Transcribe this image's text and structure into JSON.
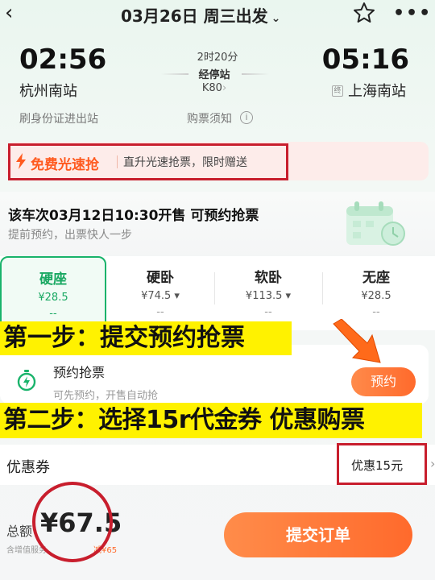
{
  "header": {
    "title": "03月26日 周三出发",
    "back_icon": "chevron-left-icon",
    "favorite_icon": "star-icon",
    "more_icon": "more-icon",
    "more_text": "•••"
  },
  "journey": {
    "depart_time": "02:56",
    "depart_station": "杭州南站",
    "arrive_time": "05:16",
    "arrive_station": "上海南站",
    "arrive_badge": "终",
    "duration": "2时20分",
    "stops_label": "经停站",
    "train_no": "K80",
    "id_exit": "刷身份证进出站",
    "ticket_notice": "购票须知"
  },
  "promo": {
    "title": "免费光速抢",
    "desc": "直升光速抢票，限时赠送",
    "accent": "#ff5a1f"
  },
  "presale": {
    "title": "该车次03月12日10:30开售 可预约抢票",
    "subtitle": "提前预约，出票快人一步"
  },
  "seats": [
    {
      "name": "硬座",
      "price": "¥28.5",
      "status": "--"
    },
    {
      "name": "硬卧",
      "price": "¥74.5 ▾",
      "status": "--"
    },
    {
      "name": "软卧",
      "price": "¥113.5 ▾",
      "status": "--"
    },
    {
      "name": "无座",
      "price": "¥28.5",
      "status": "--"
    }
  ],
  "annotations": {
    "step1": "第一步：提交预约抢票",
    "step2": "第二步：选择15r代金券 优惠购票"
  },
  "reservation": {
    "title": "预约抢票",
    "subtitle": "可先预约，开售自动抢",
    "button": "预约"
  },
  "coupon": {
    "label": "优惠券",
    "value": "优惠15元"
  },
  "footer": {
    "total_label": "总额",
    "total_amount": "¥67.5",
    "tax_note": "含增值服务",
    "save_note": "减¥65",
    "submit": "提交订单"
  },
  "colors": {
    "green": "#19b36b",
    "orange": "#ff6a2c",
    "highlight_yellow": "#fff200",
    "annotation_red": "#c81e2d"
  }
}
